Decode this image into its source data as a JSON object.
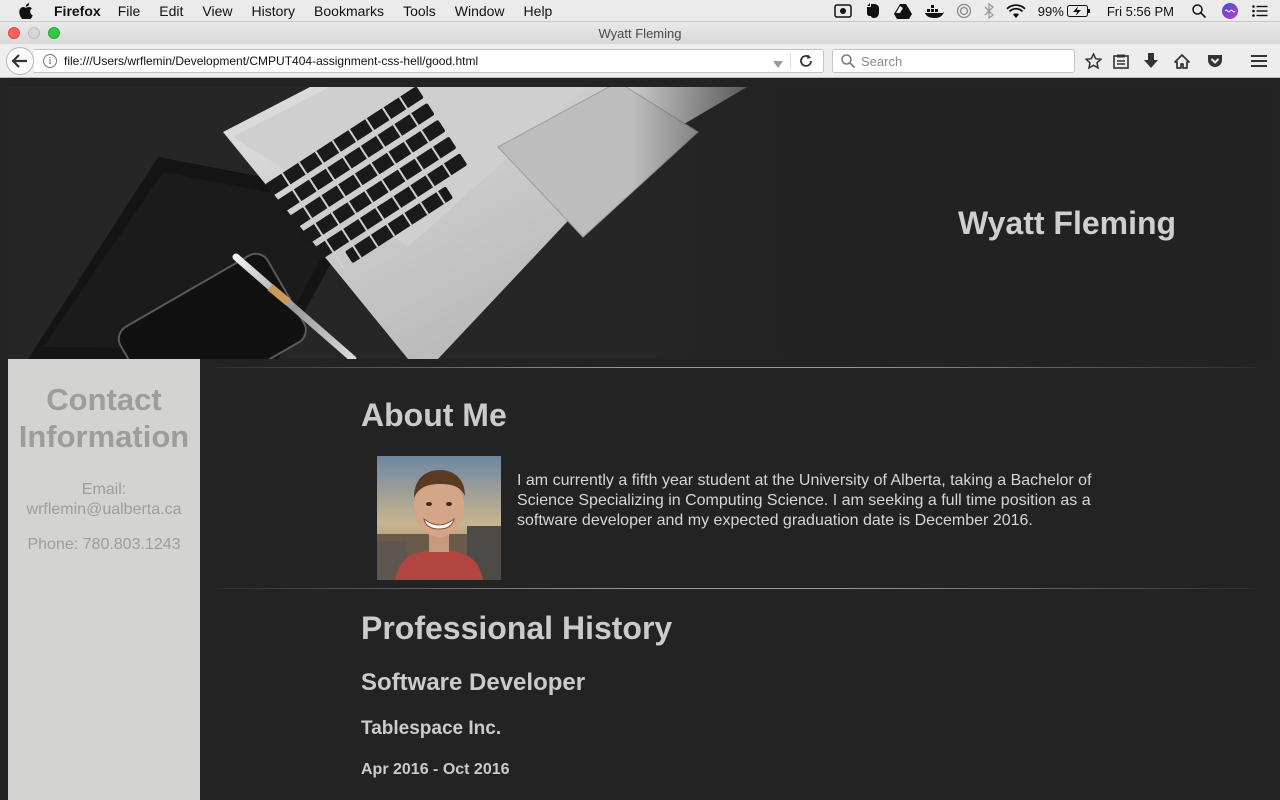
{
  "menubar": {
    "app_name": "Firefox",
    "menus": [
      "File",
      "Edit",
      "View",
      "History",
      "Bookmarks",
      "Tools",
      "Window",
      "Help"
    ],
    "battery": "99%",
    "clock": "Fri 5:56 PM"
  },
  "window": {
    "title": "Wyatt Fleming"
  },
  "toolbar": {
    "url": "file:///Users/wrflemin/Development/CMPUT404-assignment-css-hell/good.html",
    "search_placeholder": "Search"
  },
  "page": {
    "header_name": "Wyatt Fleming",
    "sidebar": {
      "title": "Contact Information",
      "email_label": "Email:",
      "email": "wrflemin@ualberta.ca",
      "phone": "Phone: 780.803.1243"
    },
    "about": {
      "heading": "About Me",
      "text": "I am currently a fifth year student at the University of Alberta, taking a Bachelor of Science Specializing in Computing Science. I am seeking a full time position as a software developer and my expected graduation date is December 2016."
    },
    "history": {
      "heading": "Professional History",
      "job_title": "Software Developer",
      "company": "Tablespace Inc.",
      "dates": "Apr 2016 - Oct 2016"
    }
  }
}
